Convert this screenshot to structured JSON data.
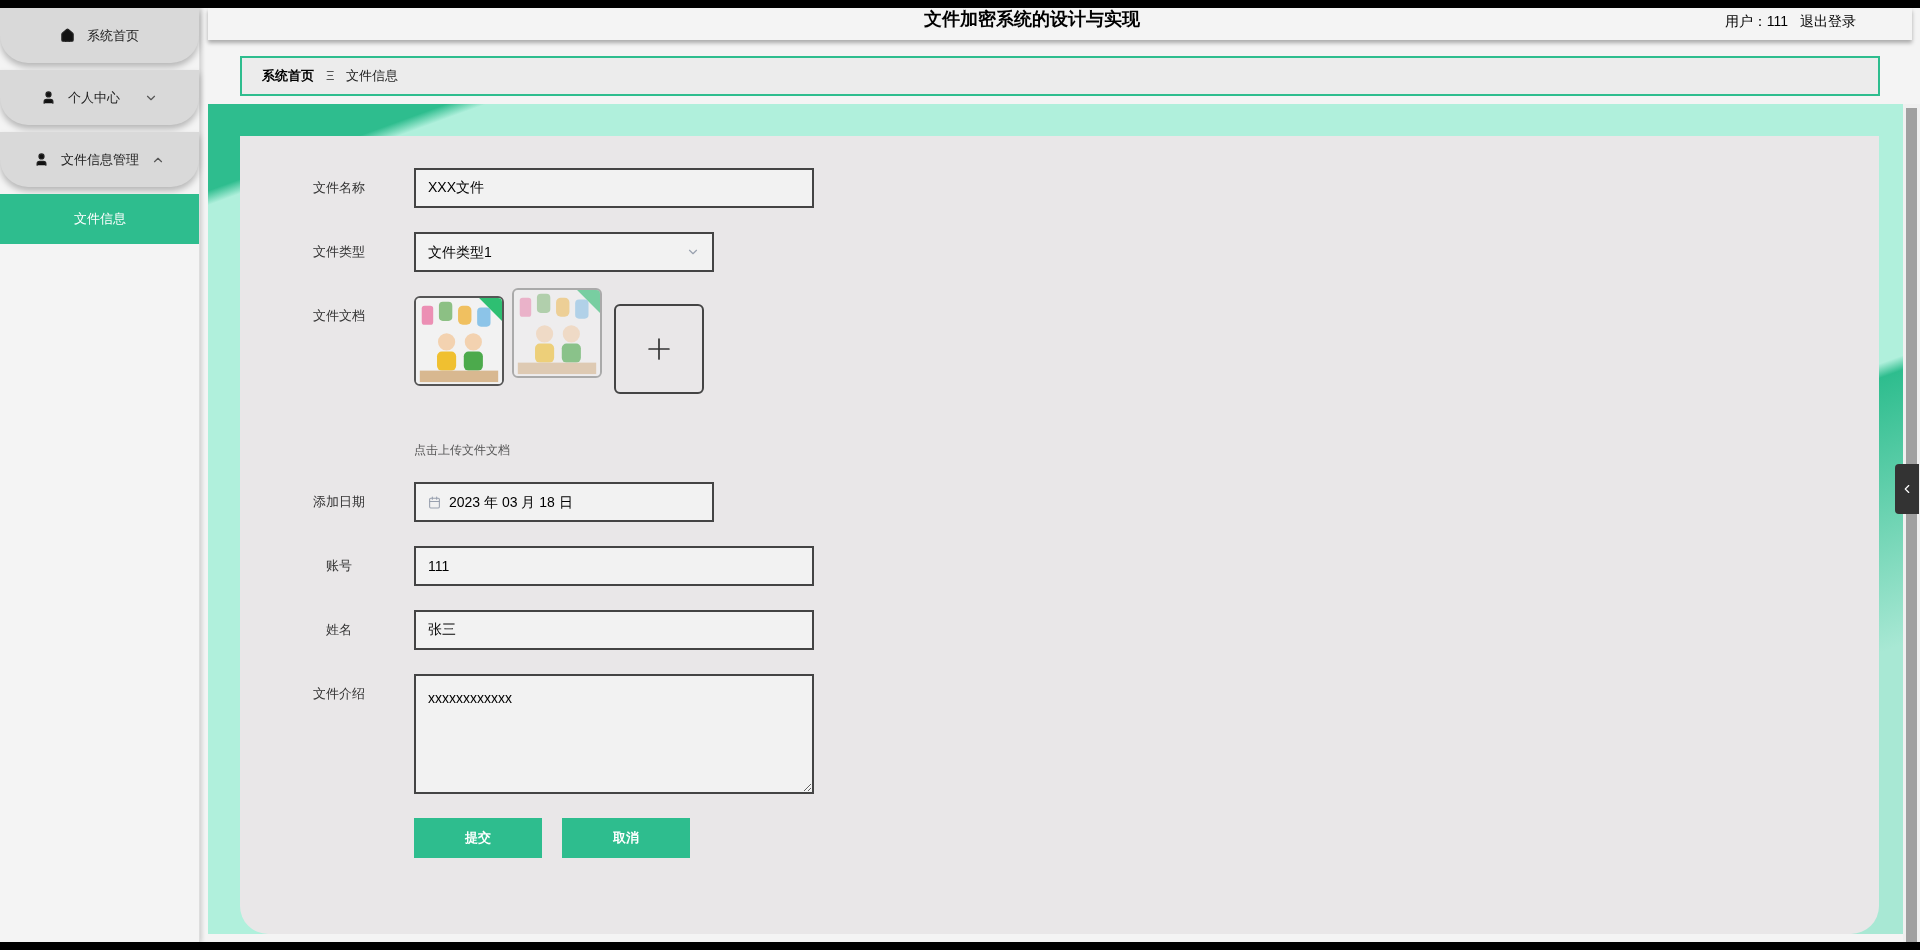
{
  "header": {
    "title": "文件加密系统的设计与实现",
    "user": "用户：111",
    "logout": "退出登录"
  },
  "sidebar": {
    "items": [
      {
        "kind": "link",
        "label": "系统首页"
      },
      {
        "kind": "menu",
        "label": "个人中心",
        "expanded": false
      },
      {
        "kind": "menu",
        "label": "文件信息管理",
        "expanded": true,
        "children": [
          {
            "label": "文件信息",
            "selected": true
          }
        ]
      }
    ]
  },
  "breadcrumb": {
    "separator": "Ξ",
    "items": [
      {
        "label": "系统首页",
        "current": false
      },
      {
        "label": "文件信息",
        "current": true
      }
    ]
  },
  "form": {
    "fields": [
      {
        "kind": "text",
        "label": "文件名称",
        "value": "XXX文件"
      },
      {
        "kind": "select",
        "label": "文件类型",
        "value": "文件类型1"
      },
      {
        "kind": "images",
        "label": "文件文档",
        "images": [
          {
            "kind": "picture",
            "faded": false
          },
          {
            "kind": "picture",
            "faded": true
          }
        ],
        "hint": "点击上传文件文档"
      },
      {
        "kind": "date",
        "label": "添加日期",
        "value": "2023 年 03 月 18 日"
      },
      {
        "kind": "text",
        "label": "账号",
        "value": "111"
      },
      {
        "kind": "text",
        "label": "姓名",
        "value": "张三"
      },
      {
        "kind": "textarea",
        "label": "文件介绍",
        "value": "xxxxxxxxxxxx"
      }
    ],
    "buttons": [
      "提交",
      "取消"
    ]
  }
}
